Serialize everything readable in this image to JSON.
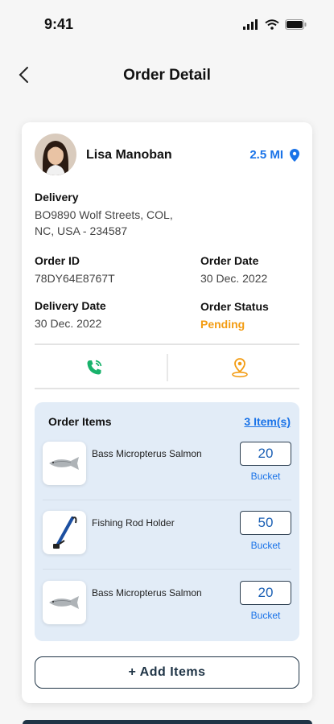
{
  "status_bar": {
    "time": "9:41"
  },
  "header": {
    "title": "Order Detail"
  },
  "customer": {
    "name": "Lisa Manoban",
    "distance": "2.5 MI"
  },
  "delivery": {
    "label": "Delivery",
    "address_line1": "BO9890 Wolf Streets, COL,",
    "address_line2": "NC, USA - 234587"
  },
  "order": {
    "id_label": "Order ID",
    "id_value": "78DY64E8767T",
    "date_label": "Order Date",
    "date_value": "30 Dec. 2022",
    "delivery_date_label": "Delivery Date",
    "delivery_date_value": "30 Dec. 2022",
    "status_label": "Order Status",
    "status_value": "Pending"
  },
  "order_items": {
    "title": "Order Items",
    "count": "3 Item(s)",
    "items": [
      {
        "name": "Bass Micropterus Salmon",
        "quantity": "20",
        "unit": "Bucket"
      },
      {
        "name": "Fishing Rod Holder",
        "quantity": "50",
        "unit": "Bucket"
      },
      {
        "name": "Bass Micropterus Salmon",
        "quantity": "20",
        "unit": "Bucket"
      }
    ]
  },
  "add_button": {
    "label": "+ Add Items"
  },
  "colors": {
    "accent": "#1a73e8",
    "pending": "#f39c12",
    "call": "#18b26b",
    "dark": "#1f3446",
    "items_bg": "#e2ecf7"
  }
}
